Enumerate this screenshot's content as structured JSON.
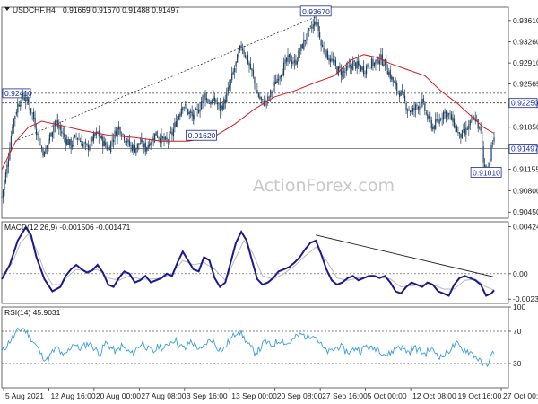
{
  "chart_data": {
    "type": "candlestick",
    "symbol_header": "USDCHF,H4",
    "ohlc_header": [
      "0.91669",
      "0.91670",
      "0.91488",
      "0.91497"
    ],
    "watermark": "ActionForex.com",
    "price_axis": {
      "ylim": [
        0.9035,
        0.9383
      ],
      "tick_labels": [
        "0.93610",
        "0.93260",
        "0.92910",
        "0.92565",
        "0.92215",
        "0.91850",
        "0.91155",
        "0.90800",
        "0.90450"
      ]
    },
    "x_axis": {
      "tick_labels": [
        "5 Aug 2021",
        "12 Aug 16:00",
        "20 Aug 00:00",
        "27 Aug 08:00",
        "3 Sep 16:00",
        "13 Sep 00:00",
        "20 Sep 08:00",
        "27 Sep 16:00",
        "5 Oct 00:00",
        "12 Oct 08:00",
        "19 Oct 16:00",
        "27 Oct 00:00"
      ]
    },
    "moving_average": [
      [
        0,
        0.9115
      ],
      [
        10,
        0.916
      ],
      [
        20,
        0.9185
      ],
      [
        30,
        0.9195
      ],
      [
        40,
        0.919
      ],
      [
        60,
        0.918
      ],
      [
        80,
        0.9172
      ],
      [
        100,
        0.9168
      ],
      [
        120,
        0.9162
      ],
      [
        140,
        0.9162
      ],
      [
        160,
        0.917
      ],
      [
        175,
        0.919
      ],
      [
        190,
        0.9215
      ],
      [
        205,
        0.9235
      ],
      [
        220,
        0.9245
      ],
      [
        235,
        0.9258
      ],
      [
        250,
        0.927
      ],
      [
        262,
        0.9295
      ],
      [
        272,
        0.9305
      ],
      [
        282,
        0.93
      ],
      [
        292,
        0.929
      ],
      [
        305,
        0.928
      ],
      [
        318,
        0.927
      ],
      [
        330,
        0.9245
      ],
      [
        342,
        0.9225
      ],
      [
        352,
        0.9205
      ],
      [
        362,
        0.9185
      ],
      [
        370,
        0.9175
      ]
    ],
    "price_path": [
      [
        0,
        0.907
      ],
      [
        4,
        0.912
      ],
      [
        8,
        0.919
      ],
      [
        12,
        0.9222
      ],
      [
        16,
        0.9236
      ],
      [
        20,
        0.9225
      ],
      [
        24,
        0.92
      ],
      [
        28,
        0.916
      ],
      [
        32,
        0.914
      ],
      [
        36,
        0.917
      ],
      [
        40,
        0.9195
      ],
      [
        44,
        0.918
      ],
      [
        48,
        0.9165
      ],
      [
        52,
        0.9155
      ],
      [
        56,
        0.917
      ],
      [
        60,
        0.916
      ],
      [
        64,
        0.915
      ],
      [
        68,
        0.9165
      ],
      [
        72,
        0.9175
      ],
      [
        76,
        0.916
      ],
      [
        80,
        0.915
      ],
      [
        84,
        0.917
      ],
      [
        88,
        0.9185
      ],
      [
        92,
        0.917
      ],
      [
        96,
        0.9155
      ],
      [
        100,
        0.915
      ],
      [
        104,
        0.916
      ],
      [
        108,
        0.915
      ],
      [
        112,
        0.9165
      ],
      [
        116,
        0.9175
      ],
      [
        120,
        0.9165
      ],
      [
        124,
        0.916
      ],
      [
        128,
        0.9175
      ],
      [
        132,
        0.92
      ],
      [
        136,
        0.9225
      ],
      [
        140,
        0.921
      ],
      [
        144,
        0.92
      ],
      [
        148,
        0.9215
      ],
      [
        152,
        0.924
      ],
      [
        156,
        0.9225
      ],
      [
        160,
        0.923
      ],
      [
        164,
        0.9215
      ],
      [
        168,
        0.923
      ],
      [
        172,
        0.926
      ],
      [
        176,
        0.929
      ],
      [
        180,
        0.932
      ],
      [
        184,
        0.93
      ],
      [
        188,
        0.9275
      ],
      [
        192,
        0.924
      ],
      [
        196,
        0.9225
      ],
      [
        200,
        0.923
      ],
      [
        204,
        0.925
      ],
      [
        208,
        0.927
      ],
      [
        212,
        0.9285
      ],
      [
        216,
        0.93
      ],
      [
        220,
        0.929
      ],
      [
        224,
        0.931
      ],
      [
        228,
        0.933
      ],
      [
        232,
        0.9345
      ],
      [
        236,
        0.936
      ],
      [
        238,
        0.9345
      ],
      [
        240,
        0.932
      ],
      [
        244,
        0.9305
      ],
      [
        248,
        0.9295
      ],
      [
        252,
        0.928
      ],
      [
        256,
        0.9275
      ],
      [
        260,
        0.928
      ],
      [
        264,
        0.929
      ],
      [
        268,
        0.9285
      ],
      [
        272,
        0.928
      ],
      [
        276,
        0.929
      ],
      [
        280,
        0.929
      ],
      [
        284,
        0.93
      ],
      [
        288,
        0.929
      ],
      [
        292,
        0.927
      ],
      [
        296,
        0.925
      ],
      [
        300,
        0.924
      ],
      [
        304,
        0.922
      ],
      [
        308,
        0.921
      ],
      [
        312,
        0.922
      ],
      [
        316,
        0.9225
      ],
      [
        320,
        0.92
      ],
      [
        324,
        0.9185
      ],
      [
        328,
        0.9195
      ],
      [
        332,
        0.921
      ],
      [
        336,
        0.9205
      ],
      [
        340,
        0.919
      ],
      [
        344,
        0.917
      ],
      [
        348,
        0.9175
      ],
      [
        352,
        0.919
      ],
      [
        356,
        0.92
      ],
      [
        360,
        0.9175
      ],
      [
        362,
        0.9125
      ],
      [
        364,
        0.9115
      ],
      [
        366,
        0.9125
      ],
      [
        368,
        0.915
      ],
      [
        370,
        0.917
      ]
    ],
    "horizontal_levels": [
      {
        "label": "0.92410",
        "value": 0.9241,
        "style": "dotted",
        "label_side": "left"
      },
      {
        "label": "0.92250",
        "value": 0.9225,
        "style": "dotted",
        "label_side": "right"
      },
      {
        "label": "0.91497",
        "value": 0.91497,
        "style": "solid",
        "label_side": "right"
      }
    ],
    "annotations": [
      {
        "label": "0.93670",
        "x": 236,
        "value": 0.9367
      },
      {
        "label": "0.91620",
        "x": 150,
        "value": 0.9162
      },
      {
        "label": "0.91010",
        "x": 364,
        "value": 0.9101
      }
    ],
    "trendline": {
      "from": [
        10,
        0.9162
      ],
      "to": [
        236,
        0.9367
      ]
    },
    "macd": {
      "label": "MACD(12,26,9) -0.001506 -0.001471",
      "tick_labels": [
        "0.004247",
        "0.00",
        "-0.002311"
      ],
      "ylim": [
        -0.0027,
        0.0047
      ],
      "macd_line": [
        [
          0,
          -0.0005
        ],
        [
          6,
          0.0008
        ],
        [
          12,
          0.003
        ],
        [
          18,
          0.0042
        ],
        [
          22,
          0.0035
        ],
        [
          26,
          0.0015
        ],
        [
          32,
          -0.0005
        ],
        [
          38,
          -0.0016
        ],
        [
          44,
          -0.0012
        ],
        [
          48,
          -0.0002
        ],
        [
          52,
          0.0004
        ],
        [
          56,
          0.0008
        ],
        [
          60,
          0.0004
        ],
        [
          64,
          0.0001
        ],
        [
          68,
          0.0003
        ],
        [
          72,
          0.0008
        ],
        [
          76,
          0.0001
        ],
        [
          80,
          -0.001
        ],
        [
          84,
          -0.0012
        ],
        [
          88,
          -0.0004
        ],
        [
          92,
          0.0002
        ],
        [
          96,
          0.0
        ],
        [
          100,
          -0.0008
        ],
        [
          104,
          -0.0006
        ],
        [
          108,
          -0.0002
        ],
        [
          112,
          -0.0008
        ],
        [
          116,
          -0.0006
        ],
        [
          120,
          -0.0004
        ],
        [
          124,
          0.0
        ],
        [
          128,
          -0.0002
        ],
        [
          132,
          0.001
        ],
        [
          136,
          0.002
        ],
        [
          140,
          0.0012
        ],
        [
          144,
          0.0004
        ],
        [
          148,
          0.0002
        ],
        [
          152,
          0.0015
        ],
        [
          156,
          0.0012
        ],
        [
          160,
          -0.0004
        ],
        [
          164,
          -0.0012
        ],
        [
          168,
          -0.0008
        ],
        [
          172,
          0.001
        ],
        [
          176,
          0.0028
        ],
        [
          180,
          0.0038
        ],
        [
          184,
          0.003
        ],
        [
          188,
          0.0012
        ],
        [
          192,
          -0.0005
        ],
        [
          196,
          -0.001
        ],
        [
          200,
          -0.0008
        ],
        [
          204,
          -0.0004
        ],
        [
          208,
          0.0002
        ],
        [
          212,
          0.0004
        ],
        [
          216,
          0.0006
        ],
        [
          220,
          0.001
        ],
        [
          224,
          0.0015
        ],
        [
          228,
          0.0022
        ],
        [
          232,
          0.0028
        ],
        [
          236,
          0.003
        ],
        [
          240,
          0.0018
        ],
        [
          244,
          0.0004
        ],
        [
          248,
          -0.0006
        ],
        [
          252,
          -0.001
        ],
        [
          256,
          -0.0008
        ],
        [
          260,
          -0.0004
        ],
        [
          264,
          -0.0002
        ],
        [
          268,
          -0.0006
        ],
        [
          272,
          -0.0004
        ],
        [
          276,
          -0.0002
        ],
        [
          280,
          -0.0002
        ],
        [
          284,
          -0.0004
        ],
        [
          288,
          -0.0002
        ],
        [
          292,
          -0.0008
        ],
        [
          296,
          -0.0016
        ],
        [
          300,
          -0.0018
        ],
        [
          304,
          -0.0012
        ],
        [
          308,
          -0.0008
        ],
        [
          312,
          -0.001
        ],
        [
          316,
          -0.0012
        ],
        [
          320,
          -0.0008
        ],
        [
          324,
          -0.001
        ],
        [
          328,
          -0.0016
        ],
        [
          332,
          -0.0018
        ],
        [
          336,
          -0.002
        ],
        [
          340,
          -0.001
        ],
        [
          344,
          -0.0004
        ],
        [
          348,
          -0.0002
        ],
        [
          352,
          -0.0004
        ],
        [
          356,
          -0.0006
        ],
        [
          360,
          -0.001
        ],
        [
          364,
          -0.002
        ],
        [
          368,
          -0.0018
        ],
        [
          370,
          -0.0015
        ]
      ],
      "signal_line": [
        [
          0,
          -0.0002
        ],
        [
          8,
          0.001
        ],
        [
          14,
          0.0028
        ],
        [
          20,
          0.0036
        ],
        [
          26,
          0.0022
        ],
        [
          32,
          0.0002
        ],
        [
          38,
          -0.001
        ],
        [
          44,
          -0.001
        ],
        [
          50,
          -0.0002
        ],
        [
          56,
          0.0004
        ],
        [
          64,
          0.0002
        ],
        [
          72,
          0.0004
        ],
        [
          80,
          -0.0004
        ],
        [
          88,
          -0.0006
        ],
        [
          96,
          -0.0002
        ],
        [
          104,
          -0.0005
        ],
        [
          112,
          -0.0005
        ],
        [
          120,
          -0.0004
        ],
        [
          128,
          0.0
        ],
        [
          136,
          0.0012
        ],
        [
          144,
          0.0008
        ],
        [
          152,
          0.001
        ],
        [
          160,
          0.0004
        ],
        [
          168,
          -0.0006
        ],
        [
          176,
          0.0015
        ],
        [
          182,
          0.003
        ],
        [
          188,
          0.002
        ],
        [
          196,
          -0.0002
        ],
        [
          204,
          -0.0005
        ],
        [
          212,
          0.0
        ],
        [
          220,
          0.0007
        ],
        [
          228,
          0.0016
        ],
        [
          236,
          0.0024
        ],
        [
          244,
          0.0012
        ],
        [
          252,
          -0.0004
        ],
        [
          260,
          -0.0006
        ],
        [
          268,
          -0.0004
        ],
        [
          276,
          -0.0003
        ],
        [
          284,
          -0.0003
        ],
        [
          292,
          -0.0005
        ],
        [
          300,
          -0.0012
        ],
        [
          308,
          -0.0011
        ],
        [
          316,
          -0.001
        ],
        [
          324,
          -0.001
        ],
        [
          332,
          -0.0014
        ],
        [
          340,
          -0.0014
        ],
        [
          348,
          -0.0006
        ],
        [
          356,
          -0.0005
        ],
        [
          364,
          -0.0012
        ],
        [
          370,
          -0.0015
        ]
      ],
      "divergence_line": {
        "from": [
          236,
          0.0035
        ],
        "to": [
          370,
          -0.0003
        ]
      }
    },
    "rsi": {
      "label": "RSI(14) 45.9031",
      "tick_labels": [
        "100",
        "70",
        "30",
        "0"
      ],
      "ylim": [
        0,
        100
      ],
      "values": [
        [
          0,
          44
        ],
        [
          6,
          58
        ],
        [
          12,
          70
        ],
        [
          16,
          74
        ],
        [
          20,
          66
        ],
        [
          26,
          52
        ],
        [
          30,
          40
        ],
        [
          34,
          34
        ],
        [
          38,
          44
        ],
        [
          42,
          50
        ],
        [
          46,
          38
        ],
        [
          50,
          46
        ],
        [
          54,
          56
        ],
        [
          58,
          48
        ],
        [
          62,
          52
        ],
        [
          66,
          56
        ],
        [
          70,
          48
        ],
        [
          74,
          42
        ],
        [
          78,
          56
        ],
        [
          82,
          50
        ],
        [
          86,
          44
        ],
        [
          90,
          52
        ],
        [
          94,
          46
        ],
        [
          98,
          42
        ],
        [
          102,
          50
        ],
        [
          106,
          56
        ],
        [
          110,
          48
        ],
        [
          114,
          44
        ],
        [
          118,
          52
        ],
        [
          122,
          48
        ],
        [
          126,
          56
        ],
        [
          130,
          60
        ],
        [
          134,
          52
        ],
        [
          138,
          48
        ],
        [
          142,
          58
        ],
        [
          146,
          52
        ],
        [
          150,
          46
        ],
        [
          154,
          56
        ],
        [
          158,
          60
        ],
        [
          162,
          50
        ],
        [
          166,
          46
        ],
        [
          170,
          56
        ],
        [
          174,
          64
        ],
        [
          178,
          72
        ],
        [
          182,
          62
        ],
        [
          186,
          52
        ],
        [
          190,
          44
        ],
        [
          194,
          48
        ],
        [
          198,
          58
        ],
        [
          202,
          52
        ],
        [
          206,
          56
        ],
        [
          210,
          60
        ],
        [
          214,
          54
        ],
        [
          218,
          58
        ],
        [
          222,
          64
        ],
        [
          226,
          66
        ],
        [
          230,
          62
        ],
        [
          234,
          68
        ],
        [
          238,
          58
        ],
        [
          242,
          48
        ],
        [
          246,
          44
        ],
        [
          250,
          48
        ],
        [
          254,
          52
        ],
        [
          258,
          46
        ],
        [
          262,
          44
        ],
        [
          266,
          50
        ],
        [
          270,
          46
        ],
        [
          274,
          52
        ],
        [
          278,
          48
        ],
        [
          282,
          50
        ],
        [
          286,
          44
        ],
        [
          290,
          40
        ],
        [
          294,
          46
        ],
        [
          298,
          52
        ],
        [
          302,
          48
        ],
        [
          306,
          44
        ],
        [
          310,
          50
        ],
        [
          314,
          46
        ],
        [
          318,
          42
        ],
        [
          322,
          48
        ],
        [
          326,
          44
        ],
        [
          330,
          38
        ],
        [
          334,
          42
        ],
        [
          338,
          50
        ],
        [
          342,
          54
        ],
        [
          346,
          48
        ],
        [
          350,
          46
        ],
        [
          354,
          42
        ],
        [
          358,
          36
        ],
        [
          362,
          26
        ],
        [
          366,
          32
        ],
        [
          370,
          46
        ]
      ]
    }
  }
}
